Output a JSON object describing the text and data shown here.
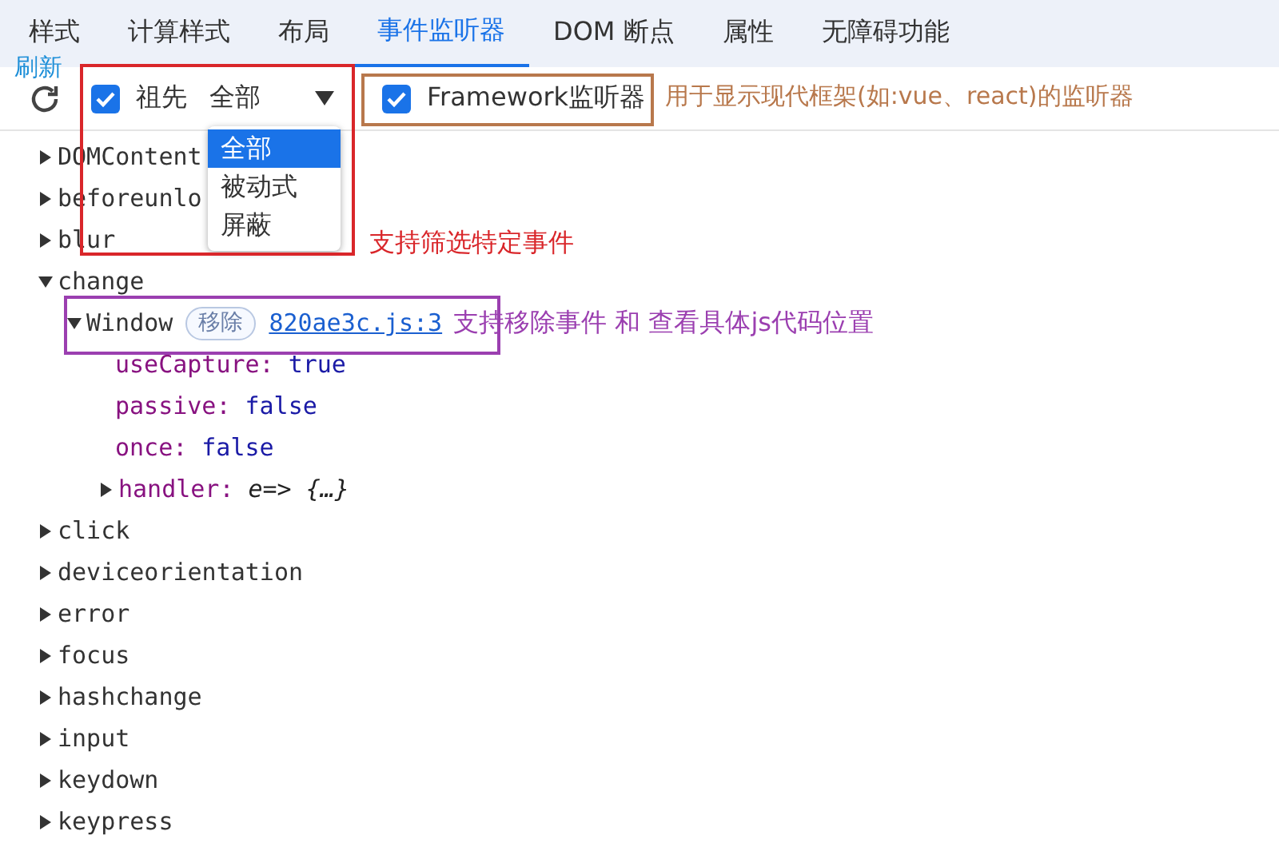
{
  "tabs": [
    {
      "label": "样式",
      "selected": false
    },
    {
      "label": "计算样式",
      "selected": false
    },
    {
      "label": "布局",
      "selected": false
    },
    {
      "label": "事件监听器",
      "selected": true
    },
    {
      "label": "DOM 断点",
      "selected": false
    },
    {
      "label": "属性",
      "selected": false
    },
    {
      "label": "无障碍功能",
      "selected": false
    }
  ],
  "toolbar": {
    "refresh_note": {
      "text": "刷新",
      "color": "#1e8fd8"
    },
    "ancestors": {
      "label": "祖先",
      "checked": true
    },
    "filter": {
      "value": "全部",
      "options": [
        {
          "label": "全部",
          "selected": true
        },
        {
          "label": "被动式",
          "selected": false
        },
        {
          "label": "屏蔽",
          "selected": false
        }
      ],
      "note": {
        "text": "支持筛选特定事件",
        "color": "#d9262a"
      }
    },
    "framework": {
      "label": "Framework监听器",
      "checked": true,
      "note": {
        "text": "用于显示现代框架(如:vue、react)的监听器",
        "color": "#b8784c"
      }
    }
  },
  "events": [
    {
      "name": "DOMContent",
      "expanded": false
    },
    {
      "name": "beforeunlo",
      "expanded": false
    },
    {
      "name": "blur",
      "expanded": false
    },
    {
      "name": "change",
      "expanded": true,
      "listeners": [
        {
          "target": "Window",
          "expanded": true,
          "remove_label": "移除",
          "source": "820ae3c.js:3",
          "note": {
            "text": "支持移除事件 和 查看具体js代码位置",
            "color": "#9b3fb0"
          },
          "properties": [
            {
              "key": "useCapture:",
              "value": "true",
              "kind": "value"
            },
            {
              "key": "passive:",
              "value": "false",
              "kind": "value"
            },
            {
              "key": "once:",
              "value": "false",
              "kind": "value"
            },
            {
              "key": "handler:",
              "value": "e=> {…}",
              "kind": "function",
              "expanded": false
            }
          ]
        }
      ]
    },
    {
      "name": "click",
      "expanded": false
    },
    {
      "name": "deviceorientation",
      "expanded": false
    },
    {
      "name": "error",
      "expanded": false
    },
    {
      "name": "focus",
      "expanded": false
    },
    {
      "name": "hashchange",
      "expanded": false
    },
    {
      "name": "input",
      "expanded": false
    },
    {
      "name": "keydown",
      "expanded": false
    },
    {
      "name": "keypress",
      "expanded": false
    }
  ]
}
